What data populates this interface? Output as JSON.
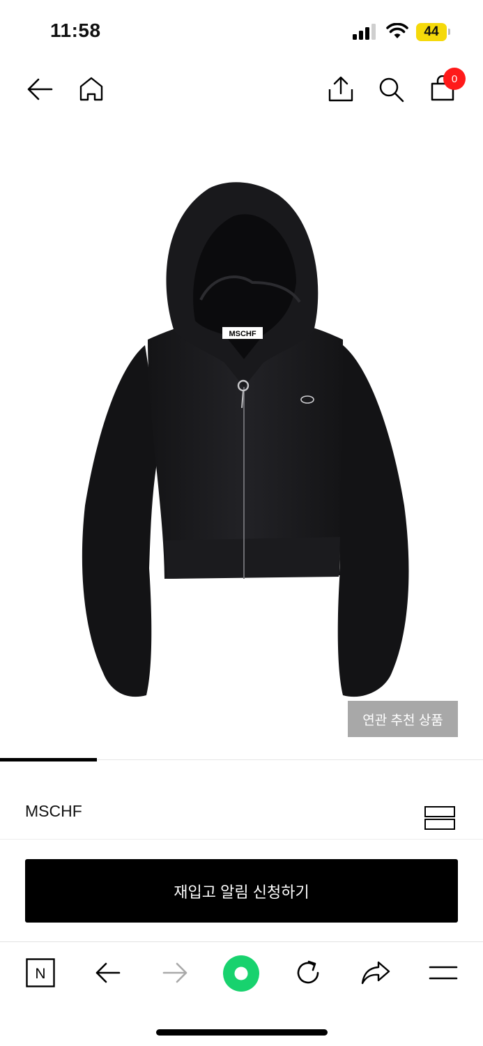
{
  "status_bar": {
    "time": "11:58",
    "battery_level": "44",
    "battery_color": "#f5d90a",
    "icons": [
      "cellular-signal-icon",
      "wifi-icon",
      "battery-icon"
    ]
  },
  "header": {
    "icons": [
      "back-arrow-icon",
      "home-icon",
      "share-icon",
      "search-icon",
      "shopping-bag-icon"
    ],
    "cart_count": "0",
    "badge_color": "#ff1a1a"
  },
  "product": {
    "image_logo_text": "MSCHF",
    "related_button_label": "연관 추천 상품",
    "image_progress_fraction": 0.2,
    "brand": "MSCHF"
  },
  "cta": {
    "restock_label": "재입고 알림 신청하기"
  },
  "browser_toolbar": {
    "icons": [
      "naver-n-icon",
      "back-arrow-icon",
      "forward-arrow-icon",
      "green-dot-home-icon",
      "reload-icon",
      "share-arrow-icon",
      "menu-icon"
    ],
    "naver_letter": "N",
    "green_accent": "#18d26e"
  }
}
